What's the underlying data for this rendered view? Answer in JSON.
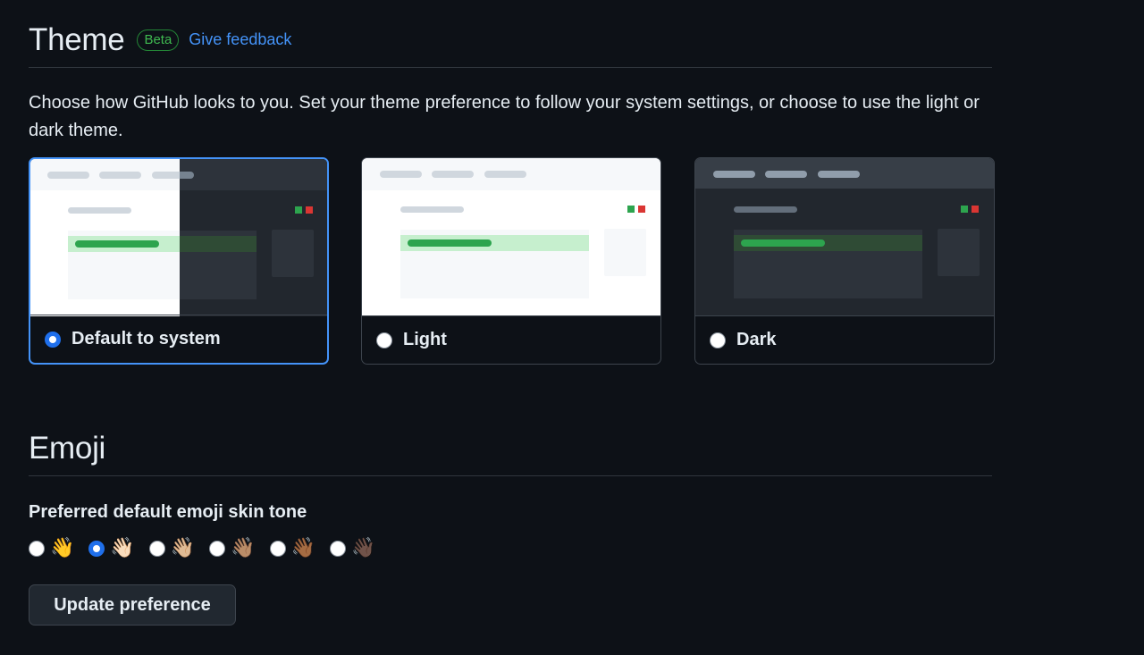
{
  "theme": {
    "title": "Theme",
    "badge": "Beta",
    "feedback_link": "Give feedback",
    "description": "Choose how GitHub looks to you. Set your theme preference to follow your system settings, or choose to use the light or dark theme.",
    "options": [
      {
        "label": "Default to system",
        "selected": true,
        "preview": "split"
      },
      {
        "label": "Light",
        "selected": false,
        "preview": "light"
      },
      {
        "label": "Dark",
        "selected": false,
        "preview": "dark"
      }
    ]
  },
  "emoji": {
    "title": "Emoji",
    "skin_tone_label": "Preferred default emoji skin tone",
    "tones": [
      {
        "emoji": "👋",
        "name": "default",
        "selected": false
      },
      {
        "emoji": "👋🏻",
        "name": "light",
        "selected": true
      },
      {
        "emoji": "👋🏼",
        "name": "medium-light",
        "selected": false
      },
      {
        "emoji": "👋🏽",
        "name": "medium",
        "selected": false
      },
      {
        "emoji": "👋🏾",
        "name": "medium-dark",
        "selected": false
      },
      {
        "emoji": "👋🏿",
        "name": "dark",
        "selected": false
      }
    ],
    "update_button": "Update preference"
  },
  "colors": {
    "background": "#0d1117",
    "accent": "#4493f8",
    "selected_radio": "#1f6feb",
    "success_green": "#3fb950",
    "border": "#30363d"
  }
}
